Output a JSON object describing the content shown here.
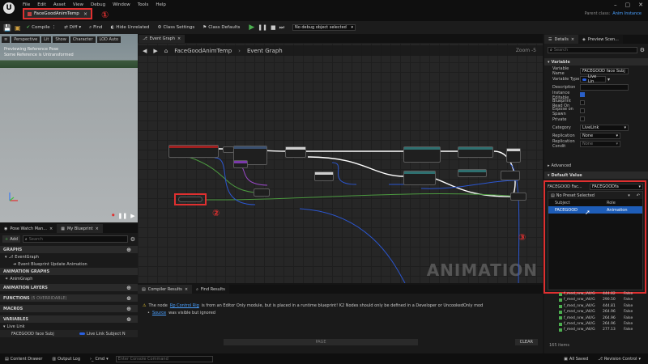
{
  "menu": [
    "File",
    "Edit",
    "Asset",
    "View",
    "Debug",
    "Window",
    "Tools",
    "Help"
  ],
  "asset_tab": "FaceGoodAnimTemp",
  "parent_class": {
    "label": "Parent class:",
    "value": "Anim Instance"
  },
  "toolbar": {
    "compile": "Compile",
    "diff": "Diff",
    "find": "Find",
    "hide_unrelated": "Hide Unrelated",
    "class_settings": "Class Settings",
    "class_defaults": "Class Defaults",
    "debug_object": "No debug object selected"
  },
  "viewport": {
    "buttons": [
      "Perspective",
      "Lit",
      "Show",
      "Character",
      "LOD Auto"
    ],
    "overlay_lines": [
      "Previewing Reference Pose",
      "Some Reference is Untransformed"
    ]
  },
  "graph": {
    "tab": "Event Graph",
    "breadcrumb_asset": "FaceGoodAnimTemp",
    "breadcrumb_graph": "Event Graph",
    "zoom": "Zoom -5",
    "watermark": "ANIMATION"
  },
  "left_tabs": {
    "pose_watch": "Pose Watch Man...",
    "my_blueprint": "My Blueprint"
  },
  "my_blueprint": {
    "add": "Add",
    "search_placeholder": "Search",
    "sections": {
      "graphs": "GRAPHS",
      "event_graph": "EventGraph",
      "event_item": "Event Blueprint Update Animation",
      "animation_graphs": "ANIMATION GRAPHS",
      "anim_graph": "AnimGraph",
      "animation_layers": "ANIMATION LAYERS",
      "functions": "FUNCTIONS",
      "functions_note": "(5 OVERRIDABLE)",
      "macros": "MACROS",
      "variables": "VARIABLES",
      "live_link": "Live Link",
      "var_name": "FACEGOOD face Subj",
      "var_type": "Live Link Subject N"
    }
  },
  "compiler": {
    "tab_results": "Compiler Results",
    "tab_find": "Find Results",
    "line1_prefix": "The node",
    "line1_node": "Rp Control Rig",
    "line1_text": "is from an Editor Only module, but is placed in a runtime blueprint! K2 Nodes should only be defined in a Developer or UncookedOnly mod",
    "line2_link": "Source",
    "line2_text": "was visible but ignored",
    "page_btn": "PAGE",
    "clear_btn": "CLEAR"
  },
  "details": {
    "tab": "Details",
    "preview_tab": "Preview Scen...",
    "search_placeholder": "Search",
    "variable_section": "Variable",
    "props": [
      {
        "label": "Variable Name",
        "value": "FACEGOOD face Subj"
      },
      {
        "label": "Variable Type",
        "value": "Live Lin"
      },
      {
        "label": "Description",
        "value": ""
      },
      {
        "label": "Instance Editable",
        "value": "checked"
      },
      {
        "label": "Blueprint Read On",
        "value": ""
      },
      {
        "label": "Expose on Spawn",
        "value": ""
      },
      {
        "label": "Private",
        "value": ""
      },
      {
        "label": "Category",
        "value": "LiveLink"
      },
      {
        "label": "Replication",
        "value": "None"
      },
      {
        "label": "Replication Condit",
        "value": "None"
      }
    ],
    "advanced": "Advanced",
    "default_value": "Default Value",
    "default_row_label": "FACEGOOD Fac...",
    "default_row_value": "FACEGOODfa",
    "preset": "No Preset Selected",
    "col_subject": "Subject",
    "col_role": "Role",
    "live_row_subject": "FACEGOOD",
    "live_row_role": "Animation"
  },
  "asset_list": {
    "rows": [
      {
        "name": "f_med_nrw_iAll/G",
        "size": "444.82",
        "flag": "False"
      },
      {
        "name": "f_med_nrw_iAll/G",
        "size": "290.50",
        "flag": "False"
      },
      {
        "name": "f_med_nrw_iAll/G",
        "size": "444.81",
        "flag": "False"
      },
      {
        "name": "f_med_nrw_iAll/G",
        "size": "264.96",
        "flag": "False"
      },
      {
        "name": "f_med_nrw_iAll/G",
        "size": "264.96",
        "flag": "False"
      },
      {
        "name": "f_med_nrw_iAll/G",
        "size": "264.96",
        "flag": "False"
      },
      {
        "name": "f_med_nrw_iAll/G",
        "size": "277.13",
        "flag": "False"
      }
    ],
    "count": "165 items"
  },
  "annotations": [
    "①",
    "②",
    "③"
  ],
  "statusbar": {
    "content_drawer": "Content Drawer",
    "output_log": "Output Log",
    "cmd": "Cmd",
    "console_placeholder": "Enter Console Command",
    "saved": "All Saved",
    "revision": "Revision Control"
  }
}
